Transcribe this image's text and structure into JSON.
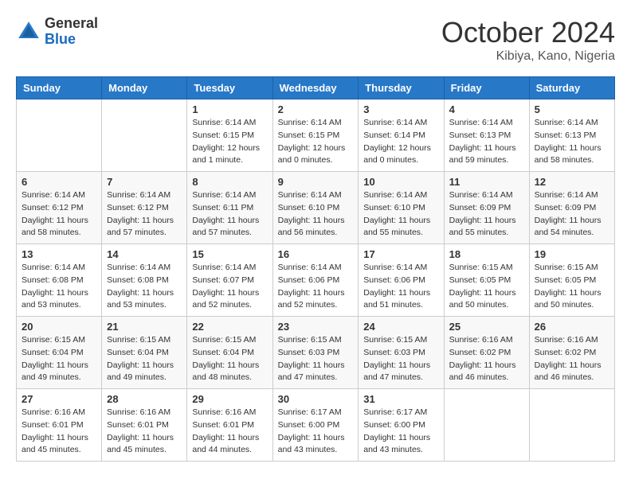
{
  "header": {
    "logo": {
      "general": "General",
      "blue": "Blue"
    },
    "title": "October 2024",
    "location": "Kibiya, Kano, Nigeria"
  },
  "calendar": {
    "weekdays": [
      "Sunday",
      "Monday",
      "Tuesday",
      "Wednesday",
      "Thursday",
      "Friday",
      "Saturday"
    ],
    "weeks": [
      [
        {
          "day": "",
          "detail": ""
        },
        {
          "day": "",
          "detail": ""
        },
        {
          "day": "1",
          "detail": "Sunrise: 6:14 AM\nSunset: 6:15 PM\nDaylight: 12 hours\nand 1 minute."
        },
        {
          "day": "2",
          "detail": "Sunrise: 6:14 AM\nSunset: 6:15 PM\nDaylight: 12 hours\nand 0 minutes."
        },
        {
          "day": "3",
          "detail": "Sunrise: 6:14 AM\nSunset: 6:14 PM\nDaylight: 12 hours\nand 0 minutes."
        },
        {
          "day": "4",
          "detail": "Sunrise: 6:14 AM\nSunset: 6:13 PM\nDaylight: 11 hours\nand 59 minutes."
        },
        {
          "day": "5",
          "detail": "Sunrise: 6:14 AM\nSunset: 6:13 PM\nDaylight: 11 hours\nand 58 minutes."
        }
      ],
      [
        {
          "day": "6",
          "detail": "Sunrise: 6:14 AM\nSunset: 6:12 PM\nDaylight: 11 hours\nand 58 minutes."
        },
        {
          "day": "7",
          "detail": "Sunrise: 6:14 AM\nSunset: 6:12 PM\nDaylight: 11 hours\nand 57 minutes."
        },
        {
          "day": "8",
          "detail": "Sunrise: 6:14 AM\nSunset: 6:11 PM\nDaylight: 11 hours\nand 57 minutes."
        },
        {
          "day": "9",
          "detail": "Sunrise: 6:14 AM\nSunset: 6:10 PM\nDaylight: 11 hours\nand 56 minutes."
        },
        {
          "day": "10",
          "detail": "Sunrise: 6:14 AM\nSunset: 6:10 PM\nDaylight: 11 hours\nand 55 minutes."
        },
        {
          "day": "11",
          "detail": "Sunrise: 6:14 AM\nSunset: 6:09 PM\nDaylight: 11 hours\nand 55 minutes."
        },
        {
          "day": "12",
          "detail": "Sunrise: 6:14 AM\nSunset: 6:09 PM\nDaylight: 11 hours\nand 54 minutes."
        }
      ],
      [
        {
          "day": "13",
          "detail": "Sunrise: 6:14 AM\nSunset: 6:08 PM\nDaylight: 11 hours\nand 53 minutes."
        },
        {
          "day": "14",
          "detail": "Sunrise: 6:14 AM\nSunset: 6:08 PM\nDaylight: 11 hours\nand 53 minutes."
        },
        {
          "day": "15",
          "detail": "Sunrise: 6:14 AM\nSunset: 6:07 PM\nDaylight: 11 hours\nand 52 minutes."
        },
        {
          "day": "16",
          "detail": "Sunrise: 6:14 AM\nSunset: 6:06 PM\nDaylight: 11 hours\nand 52 minutes."
        },
        {
          "day": "17",
          "detail": "Sunrise: 6:14 AM\nSunset: 6:06 PM\nDaylight: 11 hours\nand 51 minutes."
        },
        {
          "day": "18",
          "detail": "Sunrise: 6:15 AM\nSunset: 6:05 PM\nDaylight: 11 hours\nand 50 minutes."
        },
        {
          "day": "19",
          "detail": "Sunrise: 6:15 AM\nSunset: 6:05 PM\nDaylight: 11 hours\nand 50 minutes."
        }
      ],
      [
        {
          "day": "20",
          "detail": "Sunrise: 6:15 AM\nSunset: 6:04 PM\nDaylight: 11 hours\nand 49 minutes."
        },
        {
          "day": "21",
          "detail": "Sunrise: 6:15 AM\nSunset: 6:04 PM\nDaylight: 11 hours\nand 49 minutes."
        },
        {
          "day": "22",
          "detail": "Sunrise: 6:15 AM\nSunset: 6:04 PM\nDaylight: 11 hours\nand 48 minutes."
        },
        {
          "day": "23",
          "detail": "Sunrise: 6:15 AM\nSunset: 6:03 PM\nDaylight: 11 hours\nand 47 minutes."
        },
        {
          "day": "24",
          "detail": "Sunrise: 6:15 AM\nSunset: 6:03 PM\nDaylight: 11 hours\nand 47 minutes."
        },
        {
          "day": "25",
          "detail": "Sunrise: 6:16 AM\nSunset: 6:02 PM\nDaylight: 11 hours\nand 46 minutes."
        },
        {
          "day": "26",
          "detail": "Sunrise: 6:16 AM\nSunset: 6:02 PM\nDaylight: 11 hours\nand 46 minutes."
        }
      ],
      [
        {
          "day": "27",
          "detail": "Sunrise: 6:16 AM\nSunset: 6:01 PM\nDaylight: 11 hours\nand 45 minutes."
        },
        {
          "day": "28",
          "detail": "Sunrise: 6:16 AM\nSunset: 6:01 PM\nDaylight: 11 hours\nand 45 minutes."
        },
        {
          "day": "29",
          "detail": "Sunrise: 6:16 AM\nSunset: 6:01 PM\nDaylight: 11 hours\nand 44 minutes."
        },
        {
          "day": "30",
          "detail": "Sunrise: 6:17 AM\nSunset: 6:00 PM\nDaylight: 11 hours\nand 43 minutes."
        },
        {
          "day": "31",
          "detail": "Sunrise: 6:17 AM\nSunset: 6:00 PM\nDaylight: 11 hours\nand 43 minutes."
        },
        {
          "day": "",
          "detail": ""
        },
        {
          "day": "",
          "detail": ""
        }
      ]
    ]
  }
}
